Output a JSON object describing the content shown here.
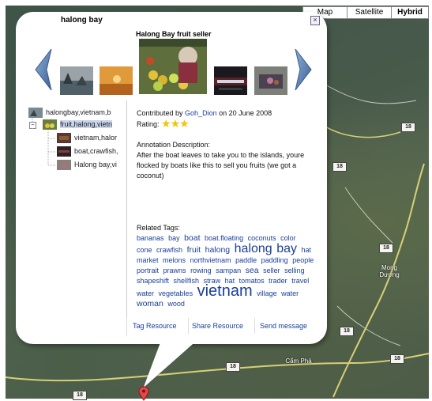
{
  "map": {
    "types": [
      "Map",
      "Satellite",
      "Hybrid"
    ],
    "selected_type": "Hybrid",
    "road_shields": [
      "18",
      "18",
      "18",
      "18",
      "18",
      "18",
      "18"
    ],
    "places": [
      "Mong Dương",
      "Cẩm Phả"
    ]
  },
  "popup": {
    "title": "halong bay",
    "close_glyph": "×",
    "carousel": {
      "caption": "Halong Bay fruit seller",
      "prev_icon": "chevron-left-icon",
      "next_icon": "chevron-right-icon"
    },
    "tree": [
      {
        "label": "halongbay,vietnam,b",
        "level": 0,
        "selected": false
      },
      {
        "label": "fruit,halong,vietn",
        "level": 1,
        "selected": true,
        "expander": "−"
      },
      {
        "label": "vietnam,halor",
        "level": 2,
        "selected": false
      },
      {
        "label": "boat,crawfish,",
        "level": 2,
        "selected": false
      },
      {
        "label": "Halong bay,vi",
        "level": 2,
        "selected": false
      }
    ],
    "info": {
      "contributed_prefix": "Contributed by ",
      "author": "Goh_Dion",
      "date_text": " on 20 June 2008",
      "rating_label": "Rating:",
      "rating": 3,
      "annotation_heading": "Annotation Description:",
      "annotation_text": "After the boat leaves to take you to the islands, youre flocked by boats like this to sell you fruits (we got a coconut)"
    },
    "tags_heading": "Related Tags:",
    "tags": [
      {
        "t": "bananas",
        "s": 1
      },
      {
        "t": "bay",
        "s": 1
      },
      {
        "t": "boat",
        "s": 2
      },
      {
        "t": "boat.floating",
        "s": 1
      },
      {
        "t": "coconuts",
        "s": 1
      },
      {
        "t": "color",
        "s": 1
      },
      {
        "t": "cone",
        "s": 1
      },
      {
        "t": "crawfish",
        "s": 1
      },
      {
        "t": "fruit",
        "s": 2
      },
      {
        "t": "halong",
        "s": 2
      },
      {
        "t": "halong",
        "s": 4
      },
      {
        "t": "bay",
        "s": 4
      },
      {
        "t": "hat",
        "s": 1
      },
      {
        "t": "market",
        "s": 1
      },
      {
        "t": "melons",
        "s": 1
      },
      {
        "t": "northvietnam",
        "s": 1
      },
      {
        "t": "paddle",
        "s": 1
      },
      {
        "t": "paddling",
        "s": 1
      },
      {
        "t": "people",
        "s": 1
      },
      {
        "t": "portrait",
        "s": 1
      },
      {
        "t": "prawns",
        "s": 1
      },
      {
        "t": "rowing",
        "s": 1
      },
      {
        "t": "sampan",
        "s": 1
      },
      {
        "t": "sea",
        "s": 2
      },
      {
        "t": "seller",
        "s": 1
      },
      {
        "t": "selling",
        "s": 1
      },
      {
        "t": "shapeshift",
        "s": 1
      },
      {
        "t": "shellfish",
        "s": 1
      },
      {
        "t": "straw",
        "s": 1
      },
      {
        "t": "hat",
        "s": 1
      },
      {
        "t": "tomatos",
        "s": 1
      },
      {
        "t": "trader",
        "s": 1
      },
      {
        "t": "travel",
        "s": 1
      },
      {
        "t": "water",
        "s": 1
      },
      {
        "t": "vegetables",
        "s": 1
      },
      {
        "t": "vietnam",
        "s": 5
      },
      {
        "t": "village",
        "s": 1
      },
      {
        "t": "water",
        "s": 1
      },
      {
        "t": "woman",
        "s": 2
      },
      {
        "t": "wood",
        "s": 1
      }
    ],
    "actions": [
      "Tag Resource",
      "Share Resource",
      "Send message"
    ]
  }
}
